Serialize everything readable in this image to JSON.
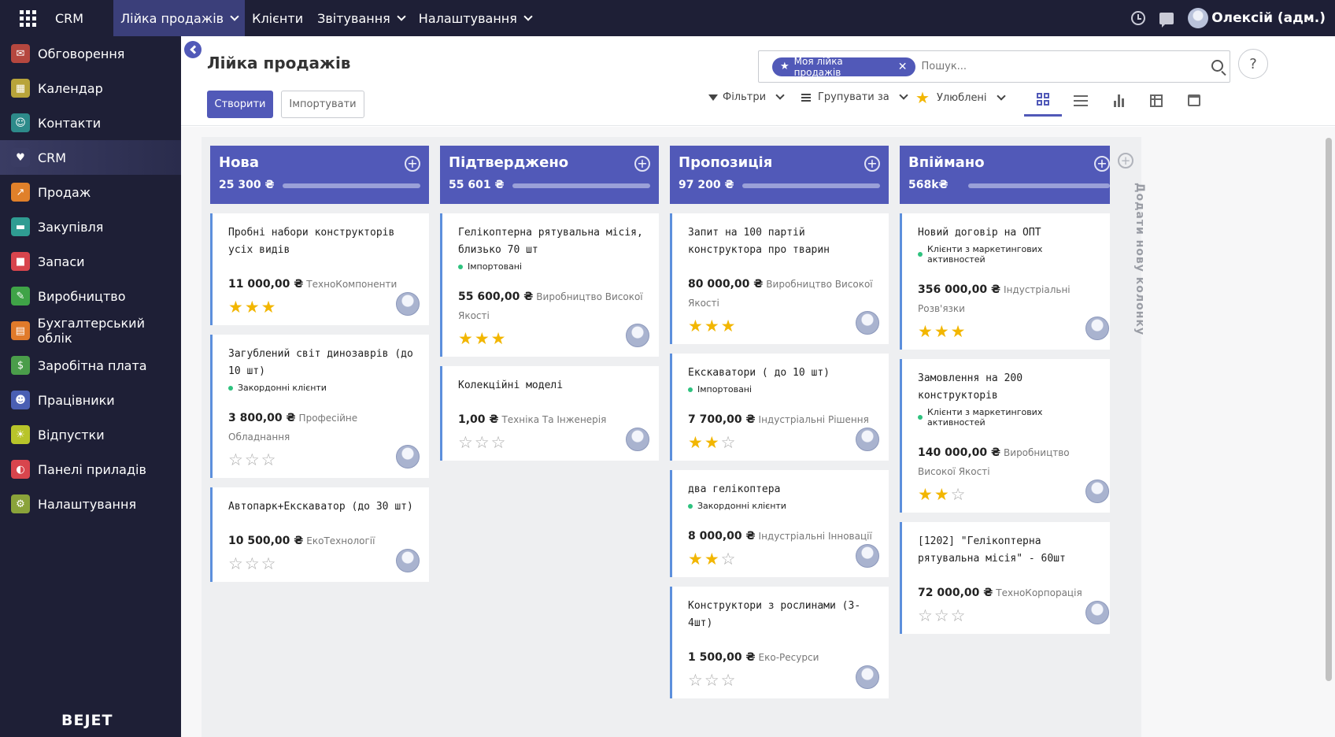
{
  "topbar": {
    "brand": "CRM",
    "menus": [
      "Лійка продажів",
      "Клієнти",
      "Звітування",
      "Налаштування"
    ],
    "user": "Олексій (адм.)"
  },
  "sidebar": {
    "items": [
      {
        "label": "Обговорення",
        "icon": "chat-icon",
        "color": "#b5473f"
      },
      {
        "label": "Календар",
        "icon": "calendar-icon",
        "color": "#b8a43a"
      },
      {
        "label": "Контакти",
        "icon": "contacts-icon",
        "color": "#2d8a8a"
      },
      {
        "label": "CRM",
        "icon": "handshake-icon",
        "color": "#3a3c63"
      },
      {
        "label": "Продаж",
        "icon": "chart-icon",
        "color": "#e0802a"
      },
      {
        "label": "Закупівля",
        "icon": "card-icon",
        "color": "#2f9c92"
      },
      {
        "label": "Запаси",
        "icon": "box-icon",
        "color": "#d8454d"
      },
      {
        "label": "Виробництво",
        "icon": "wrench-icon",
        "color": "#3fa347"
      },
      {
        "label": "Бухгалтерський облік",
        "icon": "ledger-icon",
        "color": "#e07a2a"
      },
      {
        "label": "Заробітна плата",
        "icon": "money-icon",
        "color": "#4a9d4a"
      },
      {
        "label": "Працівники",
        "icon": "people-icon",
        "color": "#4a5fb3"
      },
      {
        "label": "Відпустки",
        "icon": "sun-icon",
        "color": "#b8c42a"
      },
      {
        "label": "Панелі приладів",
        "icon": "dashboard-icon",
        "color": "#d8454d"
      },
      {
        "label": "Налаштування",
        "icon": "gear-icon",
        "color": "#8aa33a"
      }
    ],
    "logo": "BEJET"
  },
  "control": {
    "title": "Лійка продажів",
    "create": "Створити",
    "import": "Імпортувати",
    "facet": "Моя лійка продажів",
    "search_placeholder": "Пошук...",
    "filters": "Фільтри",
    "group_by": "Групувати за",
    "favorites": "Улюблені",
    "help": "?"
  },
  "columns": [
    {
      "title": "Нова",
      "total": "25 300 ₴",
      "progress": 0.1,
      "cards": [
        {
          "title": "Пробні набори конструкторів усіх видів",
          "tag": "",
          "amount": "11 000,00 ₴",
          "company": "ТехноКомпоненти",
          "stars": 3
        },
        {
          "title": "Загублений світ динозаврів (до 10 шт)",
          "tag": "Закордонні клієнти",
          "amount": "3 800,00 ₴",
          "company": "Професійне Обладнання",
          "stars": 0
        },
        {
          "title": "Автопарк+Екскаватор (до 30 шт)",
          "tag": "",
          "amount": "10 500,00 ₴",
          "company": "ЕкоТехнології",
          "stars": 0
        }
      ]
    },
    {
      "title": "Підтверджено",
      "total": "55 601 ₴",
      "progress": 0.2,
      "cards": [
        {
          "title": "Гелікоптерна рятувальна місія, близько 70 шт",
          "tag": "Імпортовані",
          "amount": "55 600,00 ₴",
          "company": "Виробництво Високої Якості",
          "stars": 3
        },
        {
          "title": "Колекційні моделі",
          "tag": "",
          "amount": "1,00 ₴",
          "company": "Техніка Та Інженерія",
          "stars": 0
        }
      ]
    },
    {
      "title": "Пропозиція",
      "total": "97 200 ₴",
      "progress": 0.3,
      "cards": [
        {
          "title": "Запит на 100 партій конструктора про тварин",
          "tag": "",
          "amount": "80 000,00 ₴",
          "company": "Виробництво Високої Якості",
          "stars": 3
        },
        {
          "title": "Екскаватори ( до 10 шт)",
          "tag": "Імпортовані",
          "amount": "7 700,00 ₴",
          "company": "Індустріальні Рішення",
          "stars": 2
        },
        {
          "title": "два гелікоптера",
          "tag": "Закордонні клієнти",
          "amount": "8 000,00 ₴",
          "company": "Індустріальні Інновації",
          "stars": 2
        },
        {
          "title": "Конструктори з рослинами (3-4шт)",
          "tag": "",
          "amount": "1 500,00 ₴",
          "company": "Еко-Ресурси",
          "stars": 0
        }
      ]
    },
    {
      "title": "Впіймано",
      "total": "568k₴",
      "progress": 1.0,
      "cards": [
        {
          "title": "Новий договір на ОПТ",
          "tag": "Клієнти з маркетингових активностей",
          "amount": "356 000,00 ₴",
          "company": "Індустріальні Розв'язки",
          "stars": 3
        },
        {
          "title": "Замовлення на 200 конструкторів",
          "tag": "Клієнти з маркетингових активностей",
          "amount": "140 000,00 ₴",
          "company": "Виробництво Високої Якості",
          "stars": 2
        },
        {
          "title": "[1202] \"Гелікоптерна рятувальна місія\" - 60шт",
          "tag": "",
          "amount": "72 000,00 ₴",
          "company": "ТехноКорпорація",
          "stars": 0
        }
      ]
    }
  ],
  "add_column": "Додати нову колонку",
  "colors": {
    "accent": "#5159b8",
    "sidebar": "#1e1f36",
    "star": "#f2b600",
    "tag_dot": "#2ec27e"
  }
}
